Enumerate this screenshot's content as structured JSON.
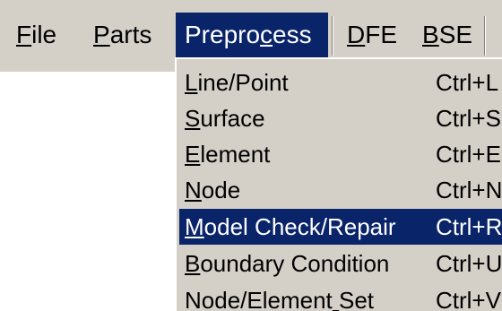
{
  "menubar": {
    "items": [
      {
        "prefix": "",
        "mnemonic": "F",
        "suffix": "ile"
      },
      {
        "prefix": "",
        "mnemonic": "P",
        "suffix": "arts"
      },
      {
        "prefix": "Prepro",
        "mnemonic": "c",
        "suffix": "ess"
      },
      {
        "prefix": "",
        "mnemonic": "D",
        "suffix": "FE"
      },
      {
        "prefix": "",
        "mnemonic": "B",
        "suffix": "SE"
      }
    ],
    "active_index": 2
  },
  "dropdown": {
    "items": [
      {
        "prefix": "",
        "mnemonic": "L",
        "suffix": "ine/Point",
        "shortcut": "Ctrl+L"
      },
      {
        "prefix": "",
        "mnemonic": "S",
        "suffix": "urface",
        "shortcut": "Ctrl+S"
      },
      {
        "prefix": "",
        "mnemonic": "E",
        "suffix": "lement",
        "shortcut": "Ctrl+E"
      },
      {
        "prefix": "",
        "mnemonic": "N",
        "suffix": "ode",
        "shortcut": "Ctrl+N"
      },
      {
        "prefix": "",
        "mnemonic": "M",
        "suffix": "odel Check/Repair",
        "shortcut": "Ctrl+R"
      },
      {
        "prefix": "",
        "mnemonic": "B",
        "suffix": "oundary Condition",
        "shortcut": "Ctrl+U"
      },
      {
        "prefix": "Node/Element",
        "mnemonic": " ",
        "suffix": "Set",
        "shortcut": "Ctrl+V"
      }
    ],
    "highlighted_index": 4
  },
  "colors": {
    "menu_background": "#d4d0c8",
    "highlight": "#0a246a",
    "highlight_text": "#ffffff",
    "text": "#000000"
  }
}
